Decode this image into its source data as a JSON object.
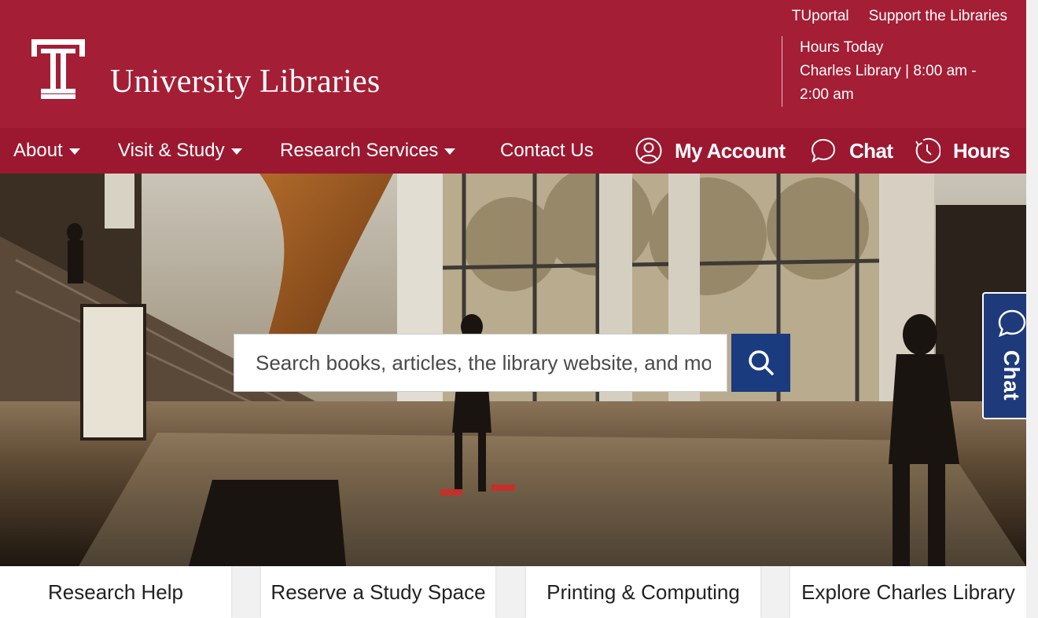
{
  "header": {
    "site_title": "University Libraries",
    "logo": "temple-t-logo",
    "util_links": [
      "TUportal",
      "Support the Libraries"
    ],
    "hours": {
      "heading": "Hours Today",
      "line1": "Charles Library | 8:00 am -",
      "line2": "2:00 am"
    },
    "brand_color": "#a41e35"
  },
  "nav": {
    "about": "About",
    "visit": "Visit & Study",
    "research": "Research Services",
    "contact": "Contact Us",
    "account": "My Account",
    "chat": "Chat",
    "hours": "Hours",
    "icons": {
      "account": "user-circle-icon",
      "chat": "chat-bubble-icon",
      "hours": "clock-icon"
    }
  },
  "search": {
    "placeholder": "Search books, articles, the library website, and more",
    "button_icon": "magnifier-icon",
    "button_color": "#1b3b7f"
  },
  "side_chat": {
    "label": "Chat",
    "icon": "chat-bubble-icon"
  },
  "quick_links": [
    "Research Help",
    "Reserve a Study Space",
    "Printing & Computing",
    "Explore Charles Library"
  ]
}
